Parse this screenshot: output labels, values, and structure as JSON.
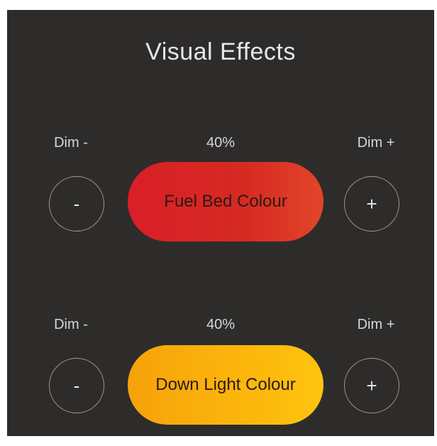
{
  "title": "Visual Effects",
  "controls": [
    {
      "dim_minus_label": "Dim -",
      "percent": "40%",
      "dim_plus_label": "Dim +",
      "minus_button": "-",
      "plus_button": "+",
      "colour_button": "Fuel Bed Colour",
      "colour": "#d9261f"
    },
    {
      "dim_minus_label": "Dim -",
      "percent": "40%",
      "dim_plus_label": "Dim +",
      "minus_button": "-",
      "plus_button": "+",
      "colour_button": "Down Light Colour",
      "colour": "#fbb30c"
    }
  ],
  "colors": {
    "background": "#2e2c2b",
    "text": "#e6e6e6",
    "circle_border": "#9b9896"
  }
}
